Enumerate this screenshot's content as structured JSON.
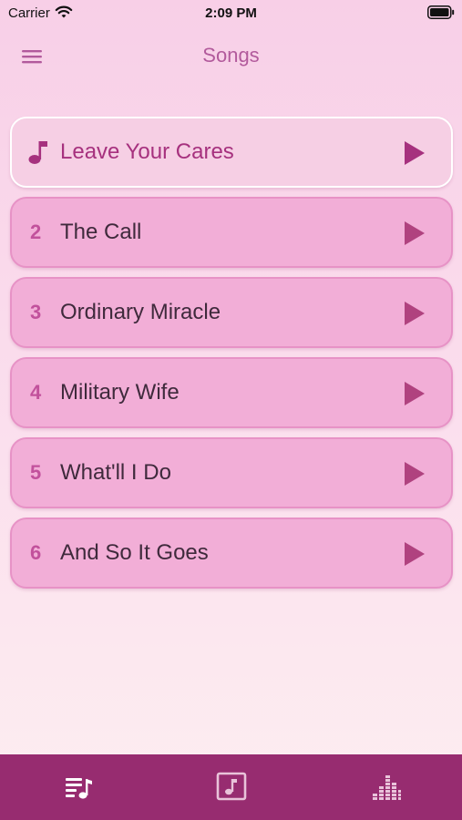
{
  "status_bar": {
    "carrier": "Carrier",
    "time": "2:09 PM"
  },
  "nav": {
    "title": "Songs",
    "menu_icon": "hamburger-menu-icon"
  },
  "songs": [
    {
      "number": "",
      "title": "Leave Your Cares",
      "active": true
    },
    {
      "number": "2",
      "title": "The Call",
      "active": false
    },
    {
      "number": "3",
      "title": "Ordinary Miracle",
      "active": false
    },
    {
      "number": "4",
      "title": "Military Wife",
      "active": false
    },
    {
      "number": "5",
      "title": "What'll I Do",
      "active": false
    },
    {
      "number": "6",
      "title": "And So It Goes",
      "active": false
    }
  ],
  "tabs": [
    {
      "icon": "playlist-icon"
    },
    {
      "icon": "music-note-square-icon"
    },
    {
      "icon": "equalizer-icon"
    }
  ],
  "colors": {
    "accent": "#b0427f",
    "row": "#f2aed7",
    "active_row": "#f6cfe4",
    "tab_bar": "#972c70"
  }
}
